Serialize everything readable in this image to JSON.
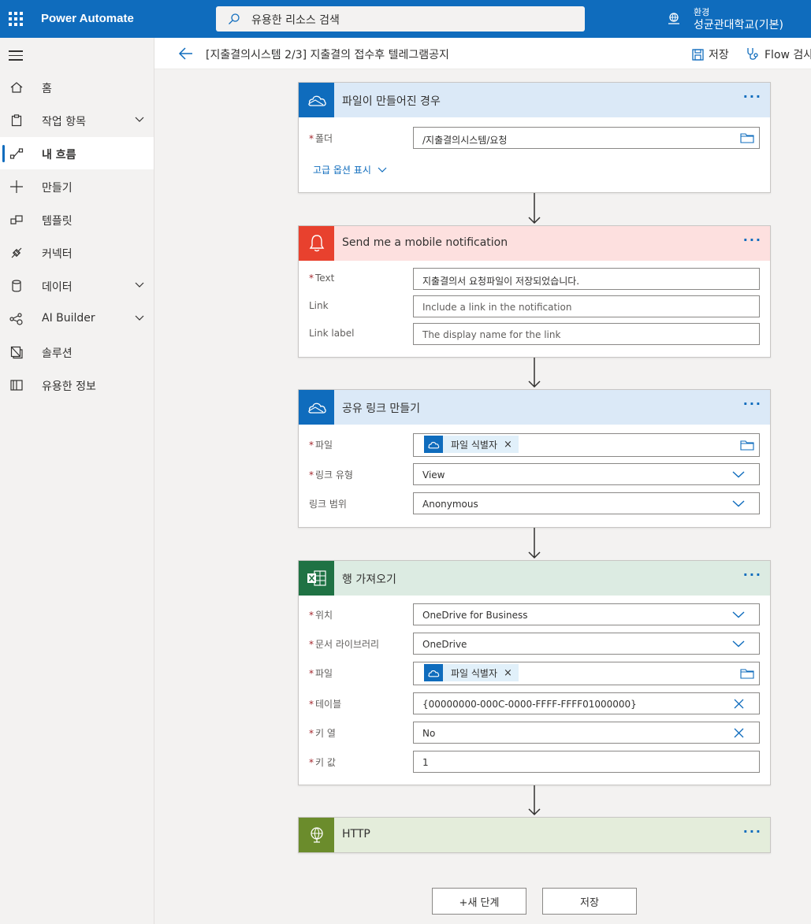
{
  "app": {
    "name": "Power Automate"
  },
  "search": {
    "placeholder": "유용한 리소스 검색"
  },
  "environment": {
    "label": "환경",
    "name": "성균관대학교(기본)"
  },
  "sidebar": {
    "items": [
      {
        "label": "홈",
        "icon": "home-icon",
        "chevron": false,
        "active": false
      },
      {
        "label": "작업 항목",
        "icon": "clipboard-icon",
        "chevron": true,
        "active": false
      },
      {
        "label": "내 흐름",
        "icon": "flow-icon",
        "chevron": false,
        "active": true
      },
      {
        "label": "만들기",
        "icon": "plus-icon",
        "chevron": false,
        "active": false
      },
      {
        "label": "템플릿",
        "icon": "template-icon",
        "chevron": false,
        "active": false
      },
      {
        "label": "커넥터",
        "icon": "connector-icon",
        "chevron": false,
        "active": false
      },
      {
        "label": "데이터",
        "icon": "database-icon",
        "chevron": true,
        "active": false
      },
      {
        "label": "AI Builder",
        "icon": "ai-builder-icon",
        "chevron": true,
        "active": false
      },
      {
        "label": "솔루션",
        "icon": "solution-icon",
        "chevron": false,
        "active": false
      },
      {
        "label": "유용한 정보",
        "icon": "book-icon",
        "chevron": false,
        "active": false
      }
    ]
  },
  "commandbar": {
    "title": "[지출결의시스템 2/3] 지출결의 접수후 텔레그램공지",
    "save": "저장",
    "checker": "Flow 검사기"
  },
  "cards": {
    "trigger": {
      "title": "파일이 만들어진 경우",
      "folder_label": "폴더",
      "folder_value": "/지출결의시스템/요청",
      "advanced": "고급 옵션 표시"
    },
    "notify": {
      "title": "Send me a mobile notification",
      "text_label": "Text",
      "text_value": "지출결의서 요청파일이 저장되었습니다.",
      "link_label": "Link",
      "link_placeholder": "Include a link in the notification",
      "linklabel_label": "Link label",
      "linklabel_placeholder": "The display name for the link"
    },
    "share": {
      "title": "공유 링크 만들기",
      "file_label": "파일",
      "file_token": "파일 식별자",
      "type_label": "링크 유형",
      "type_value": "View",
      "scope_label": "링크 범위",
      "scope_value": "Anonymous"
    },
    "rows": {
      "title": "행 가져오기",
      "location_label": "위치",
      "location_value": "OneDrive for Business",
      "library_label": "문서 라이브러리",
      "library_value": "OneDrive",
      "file_label": "파일",
      "file_token": "파일 식별자",
      "table_label": "테이블",
      "table_value": "{00000000-000C-0000-FFFF-FFFF01000000}",
      "keycol_label": "키 열",
      "keycol_value": "No",
      "keyval_label": "키 값",
      "keyval_value": "1"
    },
    "http": {
      "title": "HTTP"
    }
  },
  "footer": {
    "new_step": "+새 단계",
    "save": "저장"
  },
  "colors": {
    "brand": "#0f6cbd",
    "onedrive_header": "#dbe9f7",
    "notify_header": "#fde0df",
    "notify_icon": "#e8412e",
    "excel_header": "#dcebe2",
    "excel_icon": "#1f7244",
    "http_header": "#e4eddb",
    "http_icon": "#6b8c2c"
  }
}
